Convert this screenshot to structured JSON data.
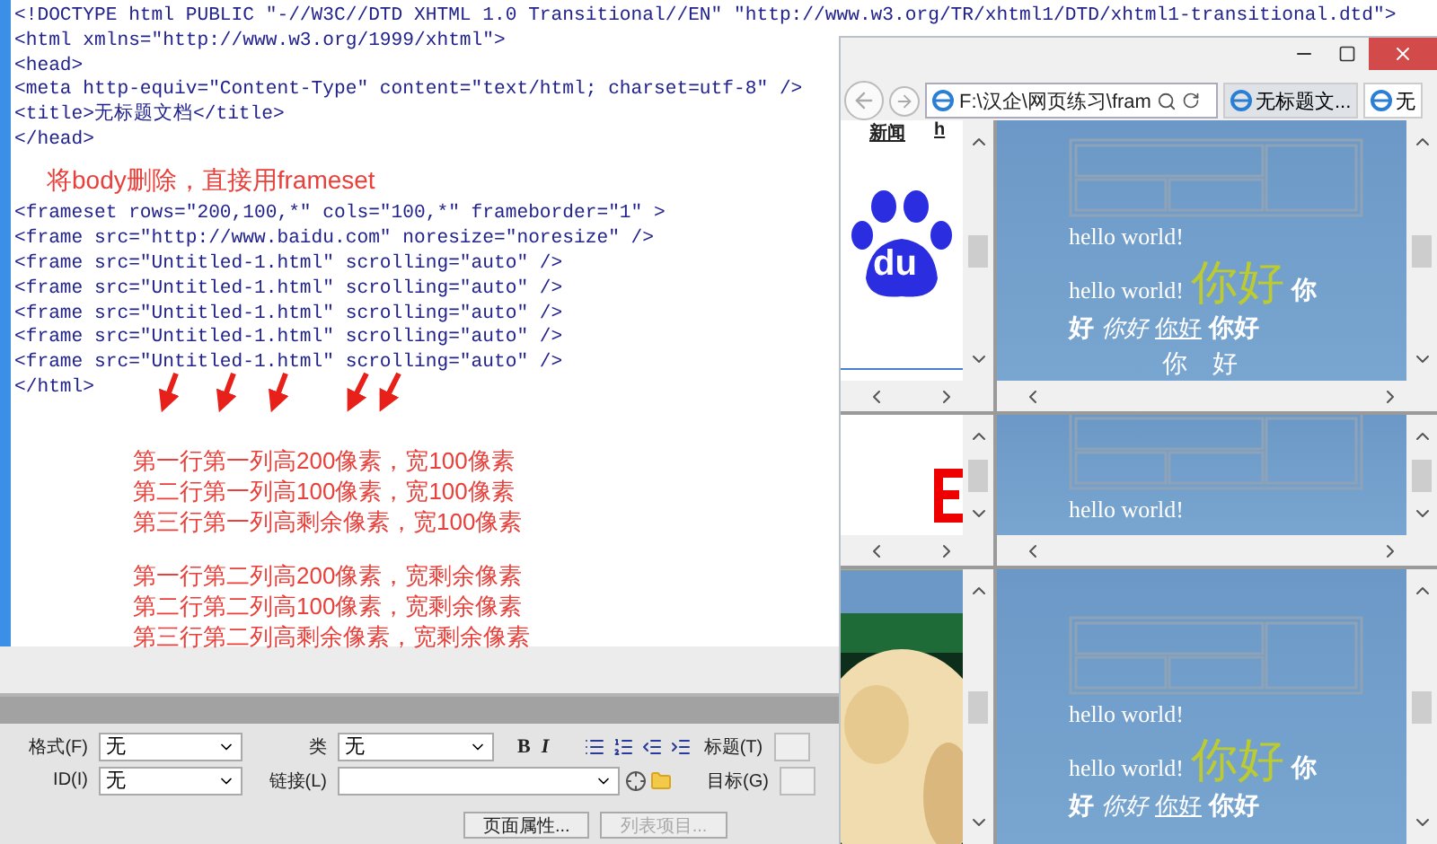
{
  "code_editor": {
    "lines": [
      {
        "kind": "code",
        "text": "<!DOCTYPE html PUBLIC \"-//W3C//DTD XHTML 1.0 Transitional//EN\" \"http://www.w3.org/TR/xhtml1/DTD/xhtml1-transitional.dtd\">"
      },
      {
        "kind": "code",
        "text": "<html xmlns=\"http://www.w3.org/1999/xhtml\">"
      },
      {
        "kind": "code",
        "text": "<head>"
      },
      {
        "kind": "code",
        "text": "<meta http-equiv=\"Content-Type\" content=\"text/html; charset=utf-8\" />"
      },
      {
        "kind": "code",
        "text": "<title>无标题文档</title>"
      },
      {
        "kind": "code",
        "text": "</head>"
      },
      {
        "kind": "note",
        "text": "将body删除，直接用frameset"
      },
      {
        "kind": "code",
        "text": "<frameset rows=\"200,100,*\" cols=\"100,*\" frameborder=\"1\" >"
      },
      {
        "kind": "code",
        "text": "<frame src=\"http://www.baidu.com\" noresize=\"noresize\" />"
      },
      {
        "kind": "code",
        "text": "<frame src=\"Untitled-1.html\" scrolling=\"auto\" />"
      },
      {
        "kind": "code",
        "text": "<frame src=\"Untitled-1.html\" scrolling=\"auto\" />"
      },
      {
        "kind": "code",
        "text": "<frame src=\"Untitled-1.html\" scrolling=\"auto\" />"
      },
      {
        "kind": "code",
        "text": "<frame src=\"Untitled-1.html\" scrolling=\"auto\" />"
      },
      {
        "kind": "code",
        "text": "<frame src=\"Untitled-1.html\" scrolling=\"auto\" />"
      },
      {
        "kind": "code",
        "text": "</html>"
      }
    ],
    "notes": [
      [
        "第一行第一列高200像素，宽100像素",
        "第二行第一列高100像素，宽100像素",
        "第三行第一列高剩余像素，宽100像素"
      ],
      [
        "第一行第二列高200像素，宽剩余像素",
        "第二行第二列高100像素，宽剩余像素",
        "第三行第二列高剩余像素，宽剩余像素"
      ]
    ]
  },
  "properties_panel": {
    "format": {
      "label": "格式(F)",
      "value": "无"
    },
    "class": {
      "label": "类",
      "value": "无"
    },
    "bold": "B",
    "italic": "I",
    "title_label": "标题(T)",
    "id": {
      "label": "ID(I)",
      "value": "无"
    },
    "link": {
      "label": "链接(L)"
    },
    "target_label": "目标(G)",
    "buttons": [
      {
        "label": "页面属性...",
        "disabled": false
      },
      {
        "label": "列表项目...",
        "disabled": true
      }
    ]
  },
  "browser": {
    "address": "F:\\汉企\\网页练习\\fram",
    "tabs": [
      {
        "label": "无标题文...",
        "selected": true
      },
      {
        "label": "无",
        "selected": false
      }
    ],
    "left_frames": [
      {
        "kind": "logo",
        "links": [
          "新闻",
          "h"
        ],
        "logo_text": "du"
      },
      {
        "kind": "fragment"
      },
      {
        "kind": "picture"
      }
    ],
    "right_frames": [
      {
        "lines": [
          [
            {
              "kind": "plain",
              "text": "hello world!"
            }
          ],
          [
            {
              "kind": "plain",
              "text": "hello world!"
            },
            {
              "kind": "big",
              "text": "你好"
            },
            {
              "kind": "bold",
              "text": "你"
            }
          ],
          [
            {
              "kind": "bold",
              "text": "好"
            },
            {
              "kind": "italic",
              "text": "你好"
            },
            {
              "kind": "underline",
              "text": "你好"
            },
            {
              "kind": "bold",
              "text": "你好"
            }
          ],
          [
            {
              "kind": "center",
              "text": "你　好"
            }
          ]
        ]
      },
      {
        "lines": [
          [
            {
              "kind": "plain",
              "text": "hello world!"
            }
          ]
        ]
      },
      {
        "lines": [
          [
            {
              "kind": "plain",
              "text": "hello world!"
            }
          ],
          [
            {
              "kind": "plain",
              "text": "hello world!"
            },
            {
              "kind": "big",
              "text": "你好"
            },
            {
              "kind": "bold",
              "text": "你"
            }
          ],
          [
            {
              "kind": "bold",
              "text": "好"
            },
            {
              "kind": "italic",
              "text": "你好"
            },
            {
              "kind": "underline",
              "text": "你好"
            },
            {
              "kind": "bold",
              "text": "你好"
            }
          ]
        ]
      }
    ]
  }
}
